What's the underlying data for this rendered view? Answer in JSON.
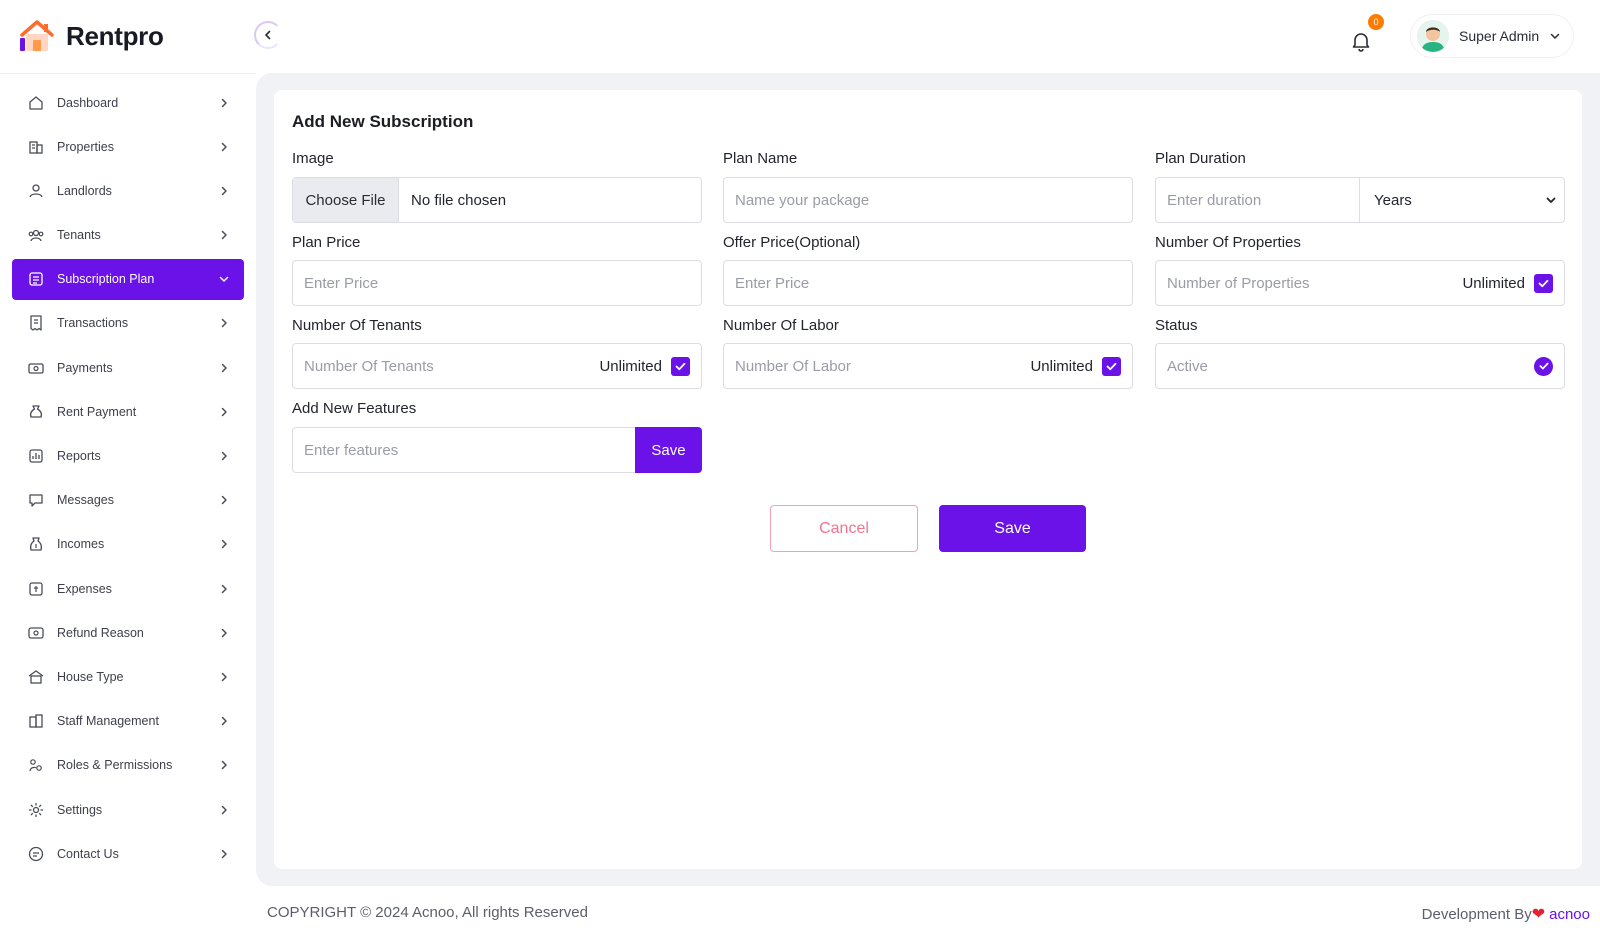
{
  "app": {
    "name": "Rentpro"
  },
  "sidebar": {
    "items": [
      {
        "label": "Dashboard",
        "icon": "home-icon"
      },
      {
        "label": "Properties",
        "icon": "building-icon"
      },
      {
        "label": "Landlords",
        "icon": "users-icon"
      },
      {
        "label": "Tenants",
        "icon": "group-icon"
      },
      {
        "label": "Subscription Plan",
        "icon": "subscription-icon",
        "active": true
      },
      {
        "label": "Transactions",
        "icon": "receipt-icon"
      },
      {
        "label": "Payments",
        "icon": "payment-icon"
      },
      {
        "label": "Rent Payment",
        "icon": "money-bag-icon"
      },
      {
        "label": "Reports",
        "icon": "report-icon"
      },
      {
        "label": "Messages",
        "icon": "chat-icon"
      },
      {
        "label": "Incomes",
        "icon": "income-icon"
      },
      {
        "label": "Expenses",
        "icon": "expense-icon"
      },
      {
        "label": "Refund Reason",
        "icon": "refund-icon"
      },
      {
        "label": "House Type",
        "icon": "house-icon"
      },
      {
        "label": "Staff Management",
        "icon": "staff-icon"
      },
      {
        "label": "Roles & Permissions",
        "icon": "roles-icon"
      },
      {
        "label": "Settings",
        "icon": "gear-icon"
      },
      {
        "label": "Contact Us",
        "icon": "contact-icon"
      }
    ]
  },
  "header": {
    "notification_count": "0",
    "user_name": "Super Admin"
  },
  "form": {
    "title": "Add New Subscription",
    "image": {
      "label": "Image",
      "button": "Choose File",
      "status": "No file chosen"
    },
    "plan_name": {
      "label": "Plan Name",
      "placeholder": "Name your package"
    },
    "plan_duration": {
      "label": "Plan Duration",
      "placeholder": "Enter duration",
      "unit": "Years"
    },
    "plan_price": {
      "label": "Plan Price",
      "placeholder": "Enter Price"
    },
    "offer_price": {
      "label": "Offer Price(Optional)",
      "placeholder": "Enter Price"
    },
    "num_properties": {
      "label": "Number Of Properties",
      "placeholder": "Number of Properties",
      "unlimited_label": "Unlimited",
      "unlimited_checked": true
    },
    "num_tenants": {
      "label": "Number Of Tenants",
      "placeholder": "Number Of Tenants",
      "unlimited_label": "Unlimited",
      "unlimited_checked": true
    },
    "num_labor": {
      "label": "Number Of Labor",
      "placeholder": "Number Of Labor",
      "unlimited_label": "Unlimited",
      "unlimited_checked": true
    },
    "status": {
      "label": "Status",
      "value": "Active",
      "checked": true
    },
    "features": {
      "label": "Add New Features",
      "placeholder": "Enter features",
      "save_label": "Save"
    },
    "cancel_label": "Cancel",
    "save_label": "Save"
  },
  "footer": {
    "copyright": "COPYRIGHT © 2024 Acnoo, All rights Reserved",
    "dev_prefix": "Development By",
    "dev_brand": "acnoo"
  },
  "colors": {
    "accent": "#6a12e8",
    "badge": "#ff7a00",
    "cancel": "#f0758f"
  }
}
